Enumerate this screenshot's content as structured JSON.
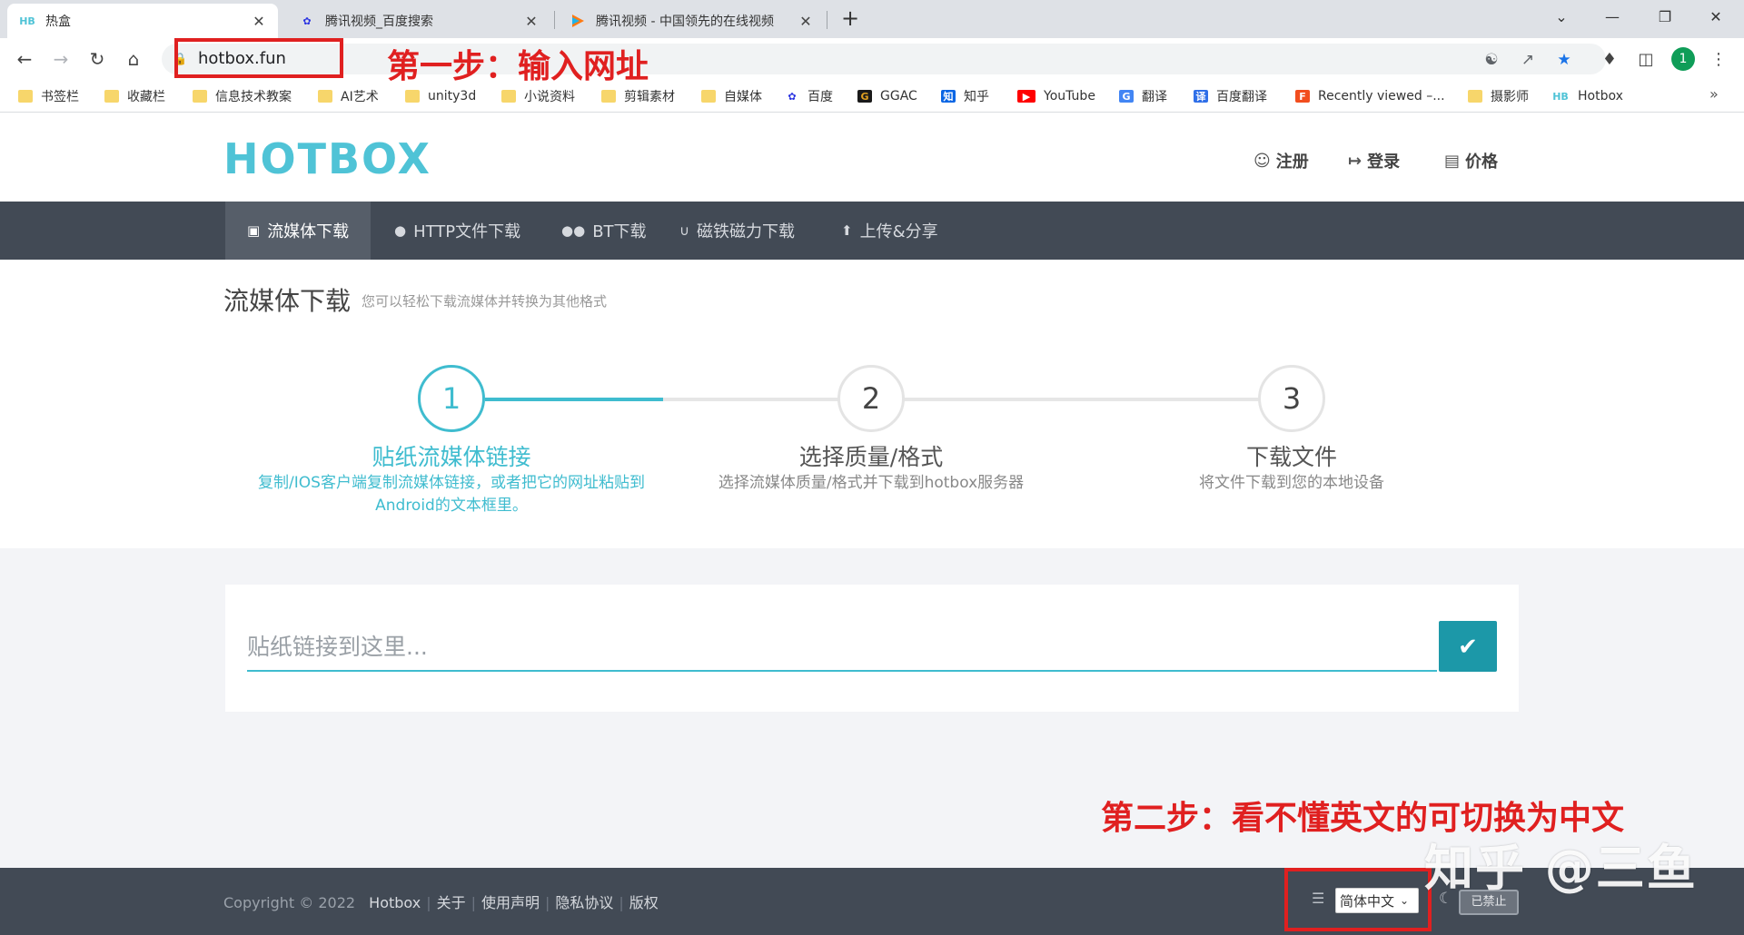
{
  "browser": {
    "tabs": [
      {
        "title": "热盒",
        "favicon": "HB"
      },
      {
        "title": "腾讯视频_百度搜索",
        "favicon": "baidu-paw"
      },
      {
        "title": "腾讯视频 - 中国领先的在线视频",
        "favicon": "tencent-video-play"
      }
    ],
    "url": "hotbox.fun",
    "avatar_letter": "1",
    "bookmarks": [
      "书签栏",
      "收藏栏",
      "信息技术教案",
      "AI艺术",
      "unity3d",
      "小说资料",
      "剪辑素材",
      "自媒体",
      "百度",
      "GGAC",
      "知乎",
      "YouTube",
      "翻译",
      "百度翻译",
      "Recently viewed –...",
      "摄影师",
      "Hotbox"
    ]
  },
  "annotations": {
    "step1": "第一步：输入网址",
    "step2": "第二步：看不懂英文的可切换为中文",
    "watermark": "知乎 @三鱼"
  },
  "site": {
    "logo": "HOTBOX",
    "header_nav": {
      "register": "注册",
      "login": "登录",
      "pricing": "价格"
    },
    "main_nav": [
      "流媒体下载",
      "HTTP文件下载",
      "BT下载",
      "磁铁磁力下载",
      "上传&分享"
    ],
    "page_title": "流媒体下载",
    "page_subtitle": "您可以轻松下载流媒体并转换为其他格式",
    "steps": [
      {
        "num": "1",
        "title": "贴纸流媒体链接",
        "desc_line1": "复制/IOS客户端复制流媒体链接，或者把它的网址粘贴到",
        "desc_line2": "Android的文本框里。"
      },
      {
        "num": "2",
        "title": "选择质量/格式",
        "desc_line1": "选择流媒体质量/格式并下载到hotbox服务器",
        "desc_line2": ""
      },
      {
        "num": "3",
        "title": "下载文件",
        "desc_line1": "将文件下载到您的本地设备",
        "desc_line2": ""
      }
    ],
    "input_placeholder": "贴纸链接到这里...",
    "footer": {
      "copyright": "Copyright © 2022",
      "links": [
        "Hotbox",
        "关于",
        "使用声明",
        "隐私协议",
        "版权"
      ],
      "language": "简体中文",
      "dark_toggle": "已禁止"
    },
    "colors": {
      "accent": "#3fbccf",
      "nav_bg": "#424a55",
      "annotation": "#e02020"
    }
  }
}
